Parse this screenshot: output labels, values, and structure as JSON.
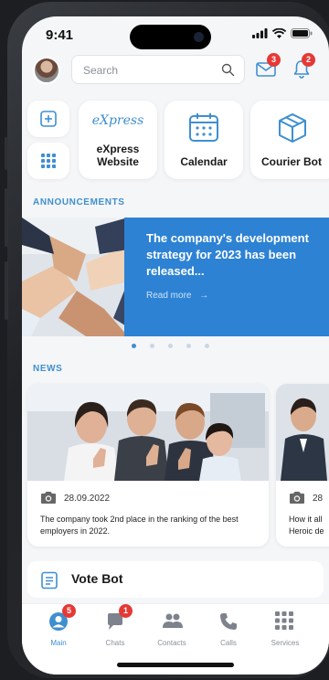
{
  "status_bar": {
    "time": "9:41"
  },
  "header": {
    "search_placeholder": "Search",
    "mail_badge": "3",
    "bell_badge": "2"
  },
  "apps": [
    {
      "label": "eXpress\nWebsite",
      "logo_text": "eXpress"
    },
    {
      "label": "Calendar"
    },
    {
      "label": "Courier Bot"
    }
  ],
  "announcements": {
    "section_title": "ANNOUNCEMENTS",
    "title": "The company's development strategy for 2023 has been released...",
    "read_more": "Read more",
    "slide_count": 5,
    "active_slide": 1
  },
  "news": {
    "section_title": "NEWS",
    "items": [
      {
        "date": "28.09.2022",
        "text": "The company took 2nd place in the ranking of the best employers in 2022."
      },
      {
        "date": "28",
        "text": "How it all\nHeroic de"
      }
    ]
  },
  "vote_bot": {
    "label": "Vote Bot"
  },
  "tabs": [
    {
      "label": "Main",
      "badge": "5"
    },
    {
      "label": "Chats",
      "badge": "1"
    },
    {
      "label": "Contacts"
    },
    {
      "label": "Calls"
    },
    {
      "label": "Services"
    }
  ],
  "colors": {
    "accent": "#3f8fd0",
    "announcement_bg": "#2d82d4",
    "badge": "#e53935"
  }
}
